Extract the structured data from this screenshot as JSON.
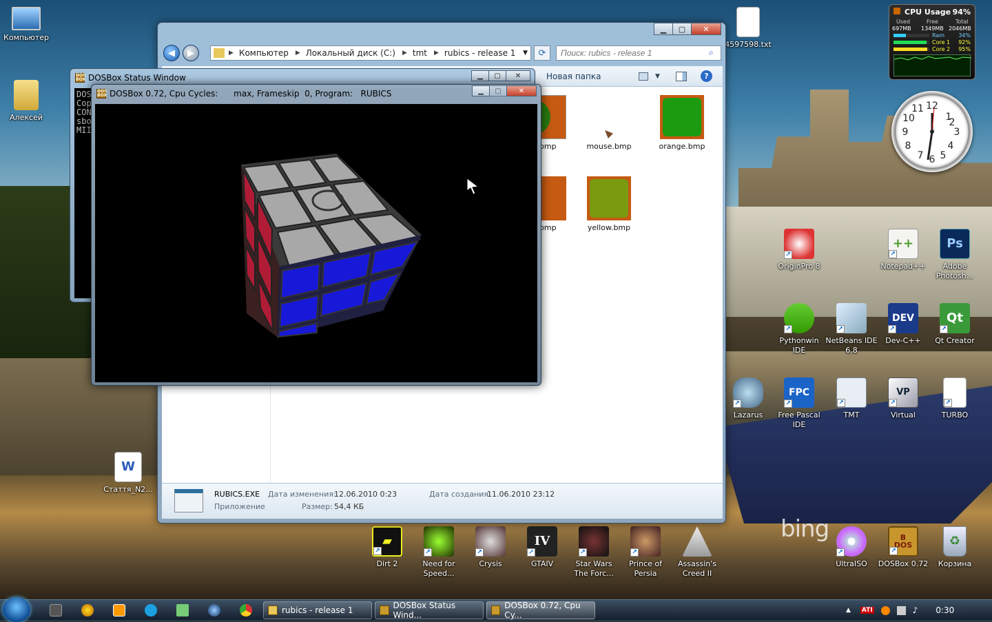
{
  "desktop": {
    "icons_left": [
      {
        "label": "Компьютер",
        "icon": "computer-icon"
      },
      {
        "label": "Алексей",
        "icon": "user-folder-icon"
      },
      {
        "label": "Стаття_N2...",
        "icon": "word-document-icon"
      }
    ],
    "icons_top": [
      {
        "label": "4597598.txt",
        "icon": "text-file-icon"
      }
    ],
    "icons_right": [
      {
        "label": "OriginPro 8",
        "icon": "originpro-icon"
      },
      {
        "label": "Notepad++",
        "icon": "notepadpp-icon"
      },
      {
        "label": "Adobe Photosh...",
        "icon": "photoshop-icon"
      },
      {
        "label": "Pythonwin IDE",
        "icon": "pythonwin-icon"
      },
      {
        "label": "NetBeans IDE 6.8",
        "icon": "netbeans-icon"
      },
      {
        "label": "Dev-C++",
        "icon": "devcpp-icon"
      },
      {
        "label": "Qt Creator",
        "icon": "qt-creator-icon"
      },
      {
        "label": "Lazarus",
        "icon": "lazarus-icon"
      },
      {
        "label": "Free Pascal IDE",
        "icon": "free-pascal-icon"
      },
      {
        "label": "TMT",
        "icon": "tmt-icon"
      },
      {
        "label": "Virtual",
        "icon": "virtualpc-icon"
      },
      {
        "label": "TURBO",
        "icon": "turbo-file-icon"
      }
    ],
    "icons_bottom": [
      {
        "label": "Dirt 2",
        "icon": "dirt2-icon"
      },
      {
        "label": "Need for Speed...",
        "icon": "nfs-icon"
      },
      {
        "label": "Crysis",
        "icon": "crysis-icon"
      },
      {
        "label": "GTAIV",
        "icon": "gtaiv-icon"
      },
      {
        "label": "Star Wars The Forc...",
        "icon": "starwars-icon"
      },
      {
        "label": "Prince of Persia",
        "icon": "prince-of-persia-icon"
      },
      {
        "label": "Assassin's Creed II",
        "icon": "assassins-creed-icon"
      },
      {
        "label": "UltraISO",
        "icon": "ultraiso-icon"
      },
      {
        "label": "DOSBox 0.72",
        "icon": "dosbox-icon"
      },
      {
        "label": "Корзина",
        "icon": "recycle-bin-icon"
      }
    ],
    "bing_text": "bing"
  },
  "explorer": {
    "breadcrumb": [
      "Компьютер",
      "Локальный диск (C:)",
      "tmt",
      "rubics - release 1"
    ],
    "search_placeholder": "Поиск: rubics - release 1",
    "toolbar_new_folder": "Новая папка",
    "files": [
      {
        "name": "...bmp",
        "color": "#c65a12",
        "inner": "#2a7a10"
      },
      {
        "name": "mouse.bmp",
        "color": "#ffffff",
        "inner": "#7a4a2a"
      },
      {
        "name": "orange.bmp",
        "color": "#c65a12",
        "inner": "#1c9a10"
      },
      {
        "name": "...bmp",
        "color": "#c65a12",
        "inner": "#c65a12"
      },
      {
        "name": "yellow.bmp",
        "color": "#c65a12",
        "inner": "#7a9a10"
      }
    ],
    "details": {
      "name": "RUBICS.EXE",
      "type": "Приложение",
      "modified_label": "Дата изменения:",
      "modified_value": "12.06.2010 0:23",
      "created_label": "Дата создания:",
      "created_value": "11.06.2010 23:12",
      "size_label": "Размер:",
      "size_value": "54,4 КБ"
    }
  },
  "dos_status": {
    "title": "DOSBox Status Window",
    "lines": [
      "DOS",
      "Cop",
      "",
      "CON",
      "sbo",
      "MII"
    ]
  },
  "dos_main": {
    "title": "DOSBox 0.72, Cpu Cycles:      max, Frameskip  0, Program:   RUBICS"
  },
  "gadgets": {
    "cpu_title": "CPU Usage",
    "cpu_percent": "94%",
    "used_label": "Used",
    "free_label": "Free",
    "total_label": "Total",
    "used_value": "697MB",
    "free_value": "1349MB",
    "total_value": "2046MB",
    "ram_label": "Ram",
    "ram_value": "34%",
    "core1_label": "Core 1",
    "core1_value": "92%",
    "core2_label": "Core 2",
    "core2_value": "95%",
    "ram_level": 0.34,
    "core1_level": 0.92,
    "core2_level": 0.95
  },
  "taskbar": {
    "tasks": [
      "rubics - release 1",
      "DOSBox Status Wind...",
      "DOSBox 0.72, Cpu Cy..."
    ],
    "tray_time": "0:30",
    "tray_ati": "ATI"
  }
}
